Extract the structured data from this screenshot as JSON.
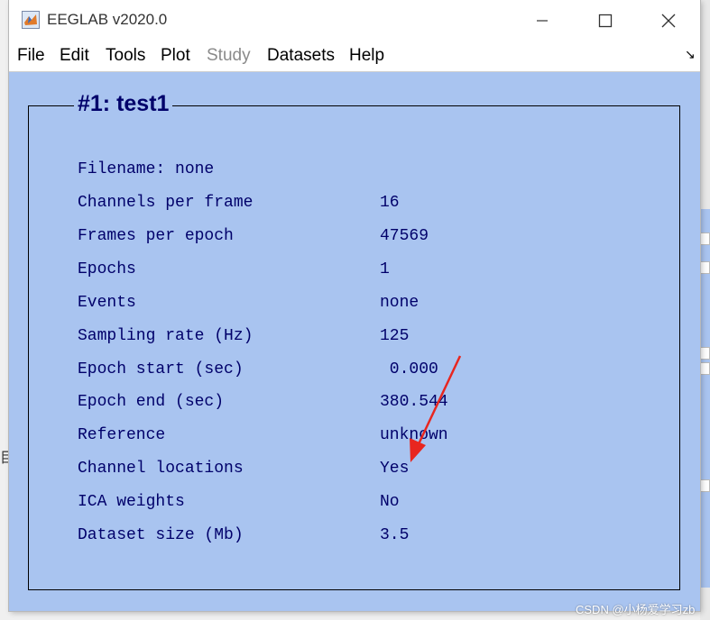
{
  "window": {
    "title": "EEGLAB v2020.0"
  },
  "menu": {
    "items": [
      {
        "label": "File",
        "enabled": true
      },
      {
        "label": "Edit",
        "enabled": true
      },
      {
        "label": "Tools",
        "enabled": true
      },
      {
        "label": "Plot",
        "enabled": true
      },
      {
        "label": "Study",
        "enabled": false
      },
      {
        "label": "Datasets",
        "enabled": true
      },
      {
        "label": "Help",
        "enabled": true
      }
    ]
  },
  "panel": {
    "title": "#1: test1",
    "filename_label": "Filename: none",
    "rows": [
      {
        "label": "Channels per frame",
        "value": "16"
      },
      {
        "label": "Frames per epoch",
        "value": "47569"
      },
      {
        "label": "Epochs",
        "value": "1"
      },
      {
        "label": "Events",
        "value": "none"
      },
      {
        "label": "Sampling rate (Hz)",
        "value": "125"
      },
      {
        "label": "Epoch start (sec)",
        "value": " 0.000"
      },
      {
        "label": "Epoch end (sec)",
        "value": "380.544"
      },
      {
        "label": "Reference",
        "value": "unknown"
      },
      {
        "label": "Channel locations",
        "value": "Yes"
      },
      {
        "label": "ICA weights",
        "value": "No"
      },
      {
        "label": "Dataset size (Mb)",
        "value": "3.5"
      }
    ]
  },
  "watermark": "CSDN @小杨爱学习zb",
  "colors": {
    "background": "#a9c4f0",
    "text": "#00006a",
    "arrow": "#e8261f"
  }
}
